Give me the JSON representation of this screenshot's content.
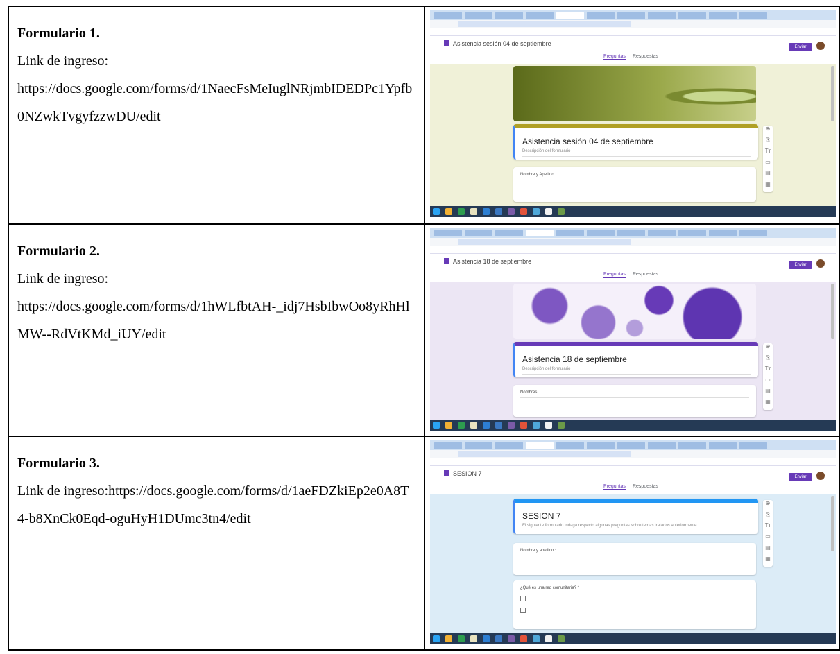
{
  "forms": [
    {
      "title": "Formulario 1.",
      "link_label": "Link de ingreso:",
      "link": "https://docs.google.com/forms/d/1NaecFsMeIuglNRjmbIDEDPc1Ypfb0NZwkTvgyfzzwDU/edit",
      "screenshot": {
        "form_title": "Asistencia sesión 04 de septiembre",
        "card_title": "Asistencia sesión 04 de septiembre",
        "card_desc": "Descripción del formulario",
        "first_field": "Nombre y Apellido",
        "tab_questions": "Preguntas",
        "tab_responses": "Respuestas",
        "send_label": "Enviar",
        "theme_color": "#f0f1d8"
      }
    },
    {
      "title": "Formulario 2.",
      "link_label": "Link de ingreso:",
      "link": "https://docs.google.com/forms/d/1hWLfbtAH-_idj7HsbIbwOo8yRhHlMW--RdVtKMd_iUY/edit",
      "screenshot": {
        "form_title": "Asistencia 18 de septiembre",
        "card_title": "Asistencia 18 de septiembre",
        "card_desc": "Descripción del formulario",
        "first_field": "Nombres",
        "tab_questions": "Preguntas",
        "tab_responses": "Respuestas",
        "send_label": "Enviar",
        "theme_color": "#ece6f4"
      }
    },
    {
      "title": "Formulario 3.",
      "link_label": "Link de ingreso:",
      "link": "https://docs.google.com/forms/d/1aeFDZkiEp2e0A8T4-b8XnCk0Eqd-oguHyH1DUmc3tn4/edit",
      "screenshot": {
        "form_title": "SESION 7",
        "card_title": "SESION 7",
        "card_desc": "El siguiente formulario indaga respecto algunas preguntas sobre temas tratados anteriormente",
        "first_field": "Nombre y apellido *",
        "second_question": "¿Qué es una red comunitaria? *",
        "tab_questions": "Preguntas",
        "tab_responses": "Respuestas",
        "send_label": "Enviar",
        "theme_color": "#dcecf7"
      }
    }
  ]
}
